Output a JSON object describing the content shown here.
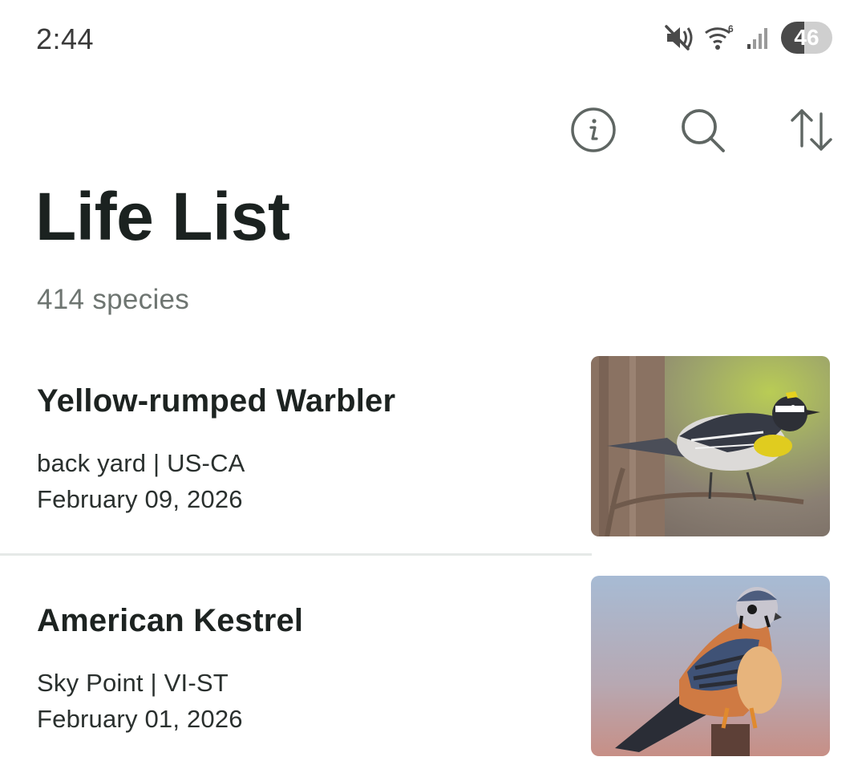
{
  "status_bar": {
    "time": "2:44",
    "battery_level": "46",
    "icons": [
      "mute-icon",
      "wifi-icon",
      "signal-icon",
      "battery-icon"
    ]
  },
  "toolbar": {
    "icons": [
      "info-icon",
      "search-icon",
      "sort-icon"
    ]
  },
  "header": {
    "title": "Life List",
    "count": "414 species"
  },
  "colors": {
    "text_primary": "#1b2220",
    "text_secondary": "#6e7571",
    "icon": "#5f6663",
    "divider": "#e5e9e7"
  },
  "species": [
    {
      "name": "Yellow-rumped Warbler",
      "location": "back yard | US-CA",
      "date": "February 09, 2026"
    },
    {
      "name": "American Kestrel",
      "location": "Sky Point | VI-ST",
      "date": "February 01, 2026"
    }
  ]
}
